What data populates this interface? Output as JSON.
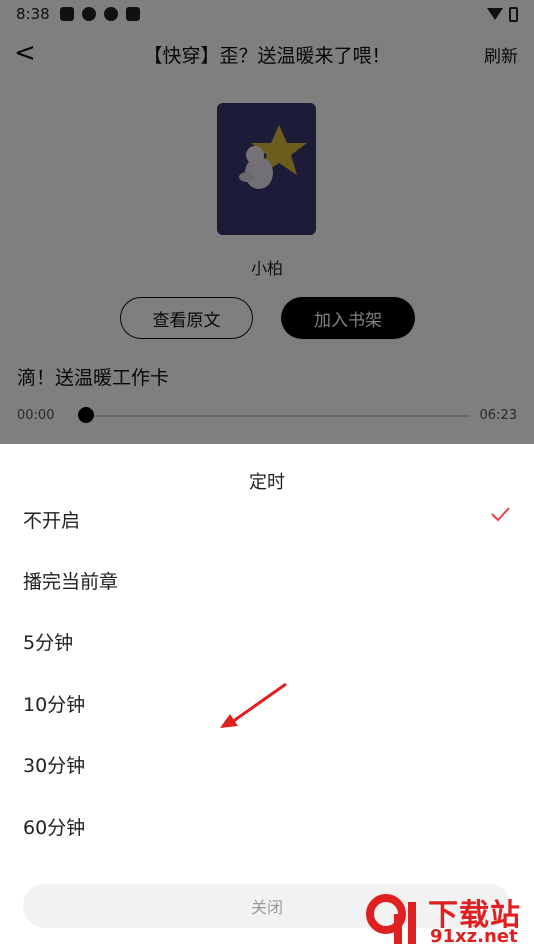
{
  "status_bar": {
    "time": "8:38"
  },
  "nav": {
    "back_label": "<",
    "title": "【快穿】歪？送温暖来了喂！",
    "refresh_label": "刷新"
  },
  "book": {
    "author": "小柏",
    "view_original_label": "查看原文",
    "add_shelf_label": "加入书架"
  },
  "player": {
    "chapter_title": "滴！送温暖工作卡",
    "current_time": "00:00",
    "total_time": "06:23",
    "progress": 0
  },
  "timer_sheet": {
    "title": "定时",
    "options": [
      {
        "label": "不开启",
        "selected": true
      },
      {
        "label": "播完当前章",
        "selected": false
      },
      {
        "label": "5分钟",
        "selected": false
      },
      {
        "label": "10分钟",
        "selected": false
      },
      {
        "label": "30分钟",
        "selected": false
      },
      {
        "label": "60分钟",
        "selected": false
      }
    ],
    "close_label": "关闭"
  },
  "watermark": {
    "text_big": "下载站",
    "text_small": "91xz.net"
  },
  "colors": {
    "accent": "#e8434f",
    "arrow": "#e02020",
    "cover_bg": "#3a3870"
  }
}
